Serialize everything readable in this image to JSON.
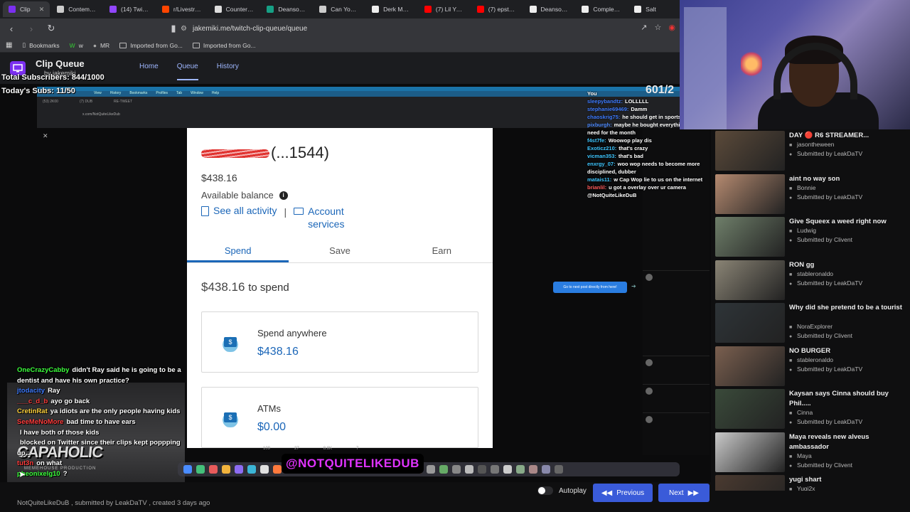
{
  "browser": {
    "tabs": [
      {
        "label": "Clip",
        "color": "#7b2ff0",
        "active": true
      },
      {
        "label": "Contempor",
        "color": "#cccccc"
      },
      {
        "label": "(14) Twitch",
        "color": "#9146ff"
      },
      {
        "label": "r/Livestrean",
        "color": "#ff4500"
      },
      {
        "label": "Counter-Str",
        "color": "#dddddd"
      },
      {
        "label": "Deansocool",
        "color": "#16a085"
      },
      {
        "label": "Can You Na",
        "color": "#cccccc"
      },
      {
        "label": "Derk Matisc",
        "color": "#eeeeee"
      },
      {
        "label": "(7) Lil Yacht",
        "color": "#ff0000"
      },
      {
        "label": "(7) epstein",
        "color": "#ff0000"
      },
      {
        "label": "Deansocool",
        "color": "#eeeeee"
      },
      {
        "label": "Complex on",
        "color": "#eeeeee"
      },
      {
        "label": "Salt",
        "color": "#eeeeee"
      }
    ],
    "url": "jakemiki.me/twitch-clip-queue/queue",
    "bookmarks": [
      {
        "label": "Bookmarks",
        "icon": "bookmark-icon"
      },
      {
        "label": "w",
        "icon": "w-icon"
      },
      {
        "label": "MR",
        "icon": "mr-icon"
      },
      {
        "label": "Imported from Go...",
        "icon": "folder-icon"
      },
      {
        "label": "Imported from Go...",
        "icon": "folder-icon"
      }
    ]
  },
  "app": {
    "title": "Clip Queue",
    "subtitle": "by jakemiki",
    "nav": [
      "Home",
      "Queue",
      "History"
    ],
    "overlay_subs": "Total Subscribers: 844/1000",
    "overlay_today": "Today's Subs: 11/50",
    "counter": "601/2"
  },
  "clip": {
    "account": "(...1544)",
    "balance": "$438.16",
    "balance_label": "Available balance",
    "link_activity": "See all activity",
    "link_account": "Account services",
    "tabs": [
      "Spend",
      "Save",
      "Earn"
    ],
    "to_spend_amount": "$438.16",
    "to_spend_label": "to spend",
    "card1_title": "Spend anywhere",
    "card1_value": "$438.16",
    "card2_title": "ATMs",
    "card2_value": "$0.00",
    "watermark": "@NOTQUITELIKEDUB",
    "blue_button": "Go to next post directly from here!",
    "capa": "CAPAHOLIC",
    "capa_sub": "MEMEHOUSE PRODUCTION"
  },
  "chat_top": [
    {
      "user": "You",
      "color": "#ffffff",
      "msg": ""
    },
    {
      "user": "sleepybandtz:",
      "color": "#3e7bff",
      "msg": "LOLLLLL"
    },
    {
      "user": "stephanie69469:",
      "color": "#3e7bff",
      "msg": "Damm"
    },
    {
      "user": "chaoskrig75:",
      "color": "#3e7bff",
      "msg": "he should get in sports"
    },
    {
      "user": "pixburgh:",
      "color": "#4f8bff",
      "msg": "maybe he bought everything he need for the month"
    },
    {
      "user": "f4st7fe:",
      "color": "#3ec6ff",
      "msg": "Woowop play dis"
    },
    {
      "user": "Exoticz210:",
      "color": "#3ec6ff",
      "msg": "that's crazy"
    },
    {
      "user": "vicman353:",
      "color": "#3ec6ff",
      "msg": "that's bad"
    },
    {
      "user": "enxrgy_07:",
      "color": "#3ec6ff",
      "msg": "woo wop needs to become more disciplined, dubber"
    },
    {
      "user": "matais11:",
      "color": "#3ec6ff",
      "msg": "w Cap Wop lie to us on the internet"
    },
    {
      "user": "brianlil:",
      "color": "#ff5a5a",
      "msg": "u got a overlay over ur camera @NotQuiteLikeDuB"
    }
  ],
  "chat_bottom": [
    {
      "user": "OneCrazyCabby",
      "color": "#3cff3c",
      "msg": "didn't Ray said he is going to be a dentist and have his own practice?"
    },
    {
      "user": "jtodacity",
      "color": "#3e7bff",
      "msg": "Ray"
    },
    {
      "user": "___c_d_b",
      "color": "#ff3c3c",
      "msg": "ayo go back"
    },
    {
      "user": "CretinRat",
      "color": "#ffd33c",
      "msg": "ya idiots are the only people having kids"
    },
    {
      "user": "SeeMeNoMore",
      "color": "#ff3c3c",
      "msg": "bad time to have ears"
    },
    {
      "user": "",
      "color": "#ffffff",
      "msg": "I have both of those kids"
    },
    {
      "user": "",
      "color": "#ffffff",
      "msg": "blocked on Twitter since their clips kept poppping up..."
    },
    {
      "user": "tut3n",
      "color": "#ff3c3c",
      "msg": "on what"
    },
    {
      "user": "pheonixelg10",
      "color": "#3cff3c",
      "msg": "?"
    }
  ],
  "queue": [
    {
      "title": "DAY 🔴 R6 STREAMER...",
      "channel": "jasontheween",
      "submitter": "Submitted by LeakDaTV",
      "thumb": "#5b4a3a"
    },
    {
      "title": "aint no way son",
      "channel": "Bonnie",
      "submitter": "Submitted by LeakDaTV",
      "thumb": "#b58a70"
    },
    {
      "title": "Give Squeex a weed right now",
      "channel": "Ludwig",
      "submitter": "Submitted by Clivent",
      "thumb": "#6f7f6a"
    },
    {
      "title": "RON gg",
      "channel": "stableronaldo",
      "submitter": "Submitted by LeakDaTV",
      "thumb": "#8a8475"
    },
    {
      "title": "Why did she pretend to be a tourist",
      "channel": "NoraExplorer",
      "submitter": "Submitted by Clivent",
      "thumb": "#2e3438"
    },
    {
      "title": "NO BURGER",
      "channel": "stableronaldo",
      "submitter": "Submitted by LeakDaTV",
      "thumb": "#7a5f4f"
    },
    {
      "title": "Kaysan says Cinna should buy Phil.....",
      "channel": "Cinna",
      "submitter": "Submitted by LeakDaTV",
      "thumb": "#3a4a3a"
    },
    {
      "title": "Maya reveals new alveus ambassador",
      "channel": "Maya",
      "submitter": "Submitted by Clivent",
      "thumb": "#c9c9c9"
    },
    {
      "title": "yugi shart",
      "channel": "Yugi2x",
      "submitter": "Submitted by LeakDaTV",
      "thumb": "#4a3a30"
    }
  ],
  "footer": {
    "credit": "NotQuiteLikeDuB , submitted by LeakDaTV , created 3 days ago",
    "autoplay": "Autoplay",
    "prev": "Previous",
    "next": "Next"
  }
}
